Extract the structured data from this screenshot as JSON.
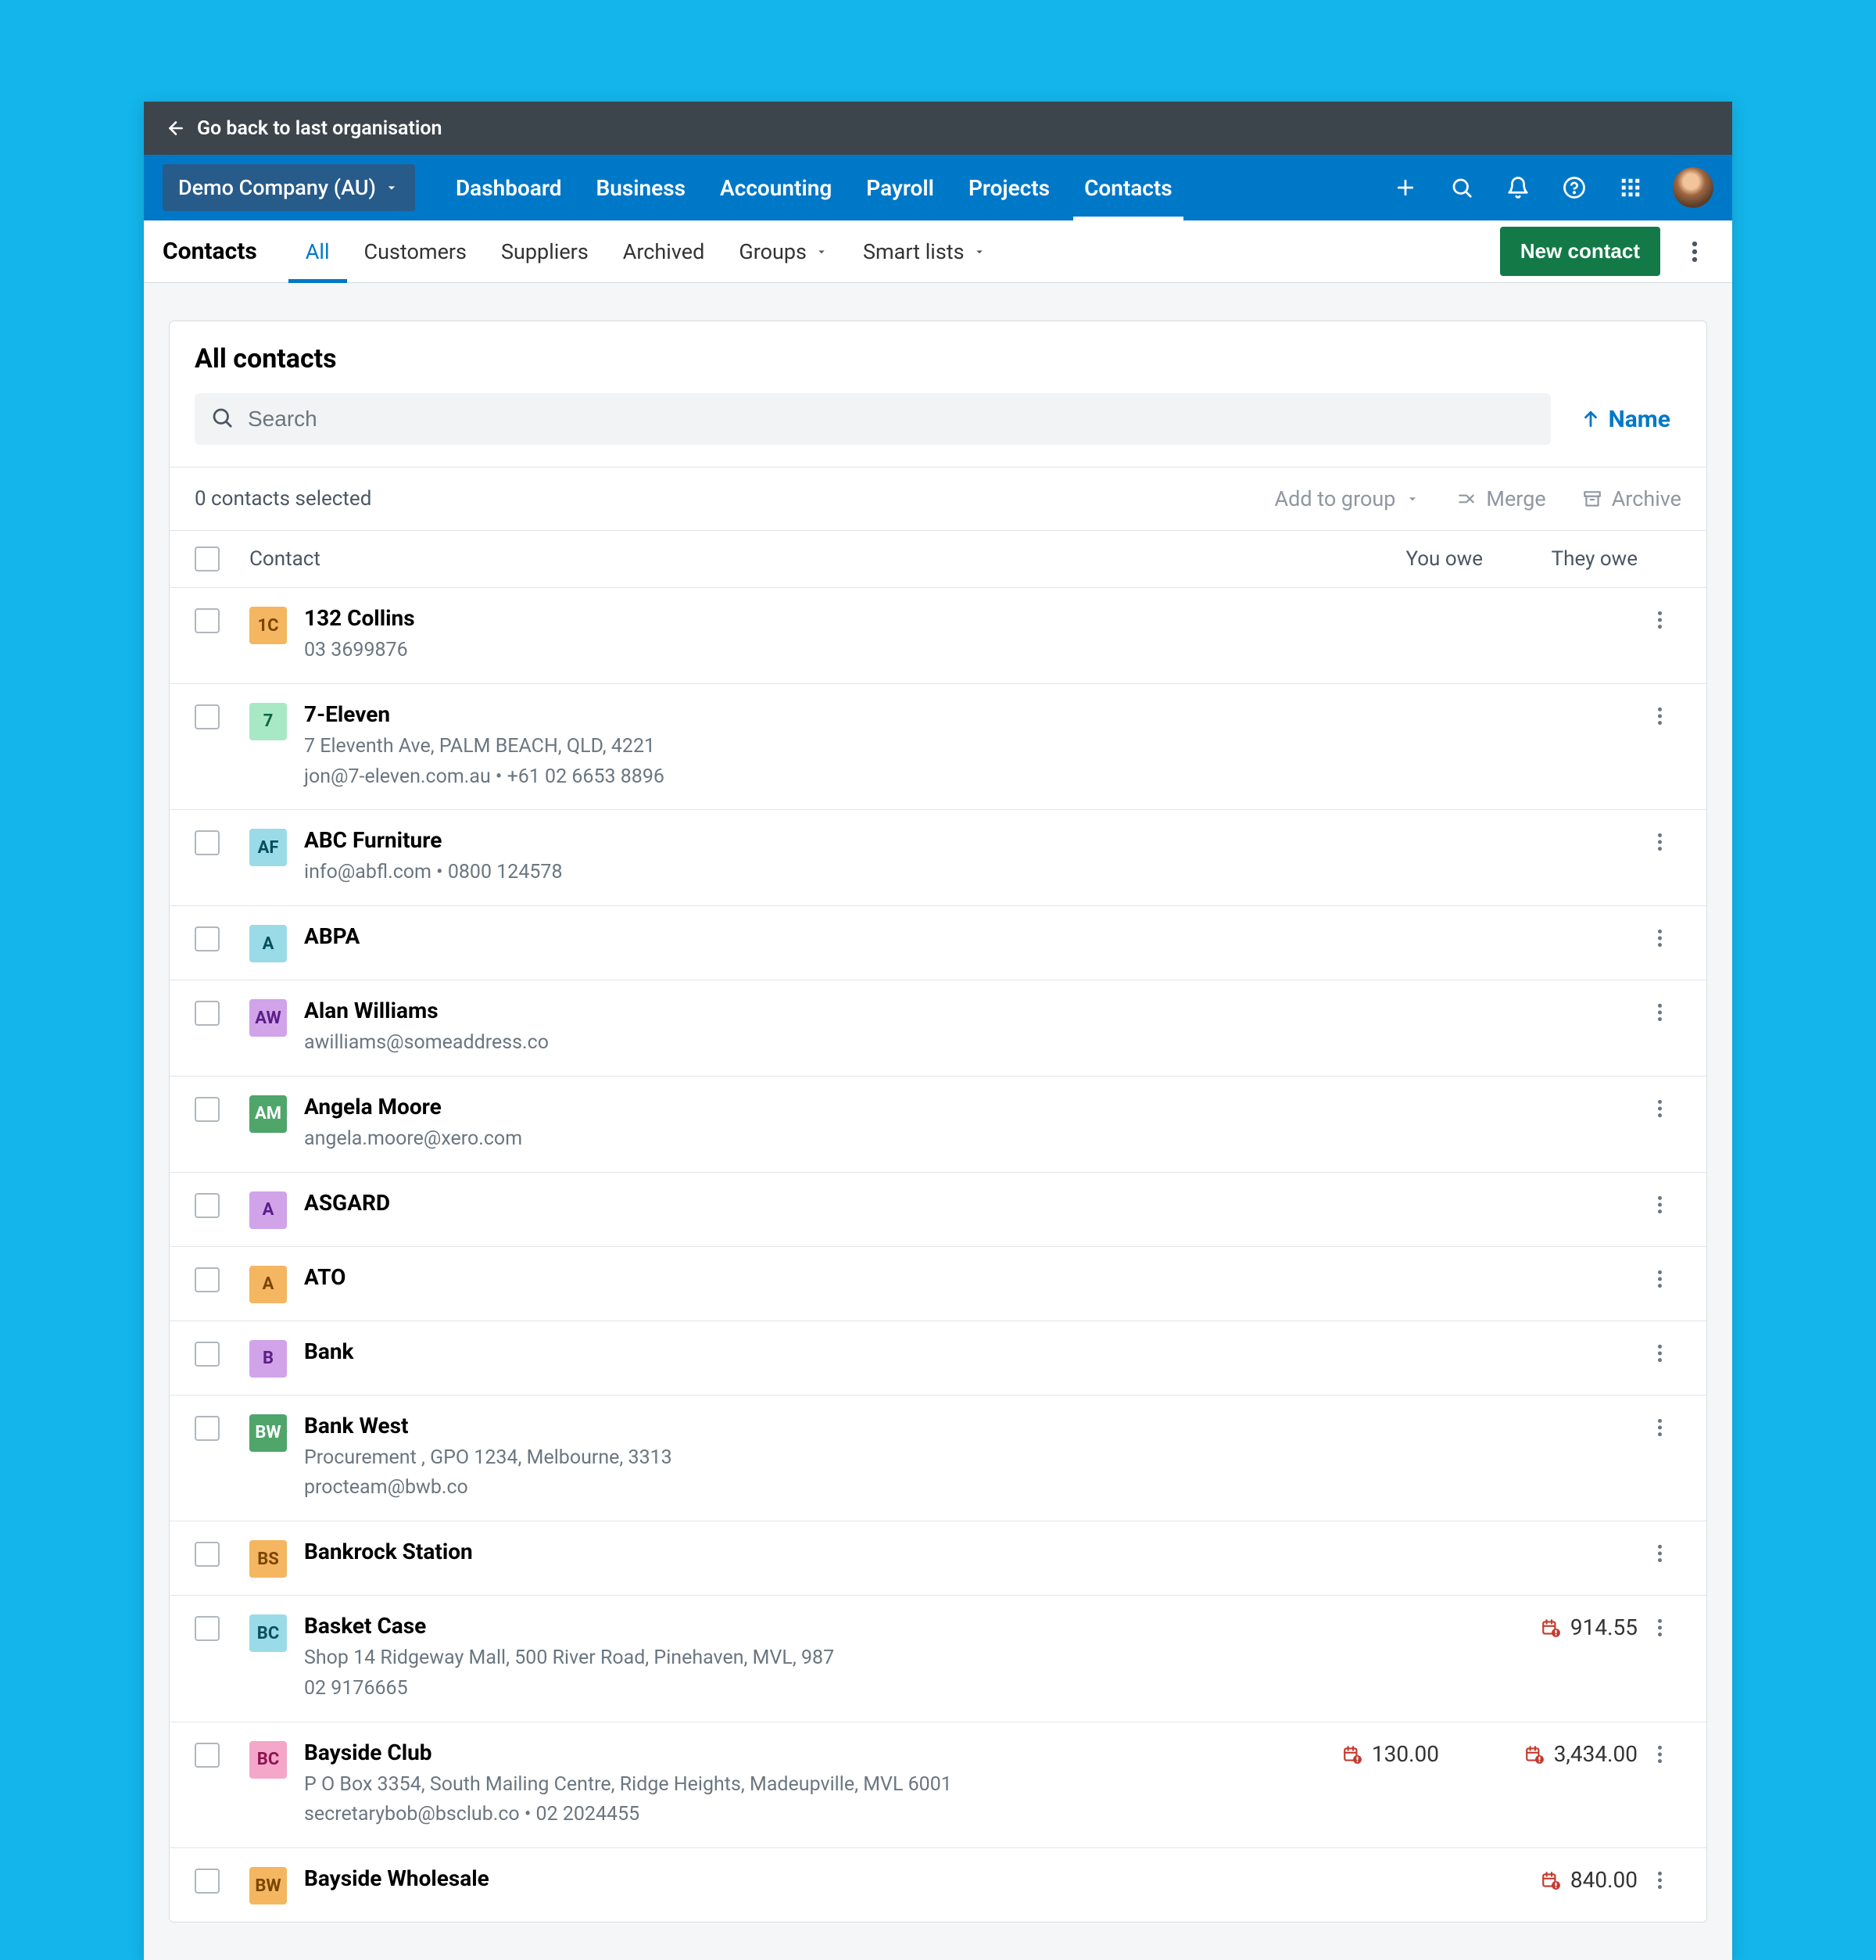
{
  "topbar": {
    "back_label": "Go back to last organisation"
  },
  "org": {
    "name": "Demo Company (AU)"
  },
  "nav": {
    "items": [
      "Dashboard",
      "Business",
      "Accounting",
      "Payroll",
      "Projects",
      "Contacts"
    ],
    "active": 5
  },
  "subnav": {
    "label": "Contacts",
    "tabs": [
      "All",
      "Customers",
      "Suppliers",
      "Archived",
      "Groups",
      "Smart lists"
    ],
    "active": 0,
    "new_button": "New contact"
  },
  "panel": {
    "title": "All contacts",
    "search_placeholder": "Search",
    "sort_label": "Name",
    "selected_text": "0 contacts selected",
    "actions": {
      "add_to_group": "Add to group",
      "merge": "Merge",
      "archive": "Archive"
    },
    "columns": {
      "contact": "Contact",
      "you_owe": "You owe",
      "they_owe": "They owe"
    }
  },
  "contacts": [
    {
      "initials": "1C",
      "bg": "#f4b661",
      "fg": "#7a4500",
      "name": "132 Collins",
      "line1": "03 3699876"
    },
    {
      "initials": "7",
      "bg": "#a8e8c5",
      "fg": "#0a6742",
      "name": "7-Eleven",
      "line1": "7 Eleventh Ave, PALM BEACH, QLD, 4221",
      "line2": "jon@7-eleven.com.au   •   +61 02 6653 8896"
    },
    {
      "initials": "AF",
      "bg": "#9bdbe8",
      "fg": "#064e5d",
      "name": "ABC Furniture",
      "line1": "info@abfl.com   •   0800 124578"
    },
    {
      "initials": "A",
      "bg": "#9bdbe8",
      "fg": "#064e5d",
      "name": "ABPA"
    },
    {
      "initials": "AW",
      "bg": "#d1a3e8",
      "fg": "#5b1e89",
      "name": "Alan Williams",
      "line1": "awilliams@someaddress.co"
    },
    {
      "initials": "AM",
      "bg": "#4fa56a",
      "fg": "#ffffff",
      "name": "Angela Moore",
      "line1": "angela.moore@xero.com"
    },
    {
      "initials": "A",
      "bg": "#d1a3e8",
      "fg": "#5b1e89",
      "name": "ASGARD"
    },
    {
      "initials": "A",
      "bg": "#f4b661",
      "fg": "#7a4500",
      "name": "ATO"
    },
    {
      "initials": "B",
      "bg": "#d1a3e8",
      "fg": "#5b1e89",
      "name": "Bank"
    },
    {
      "initials": "BW",
      "bg": "#4fa56a",
      "fg": "#ffffff",
      "name": "Bank West",
      "line1": "Procurement , GPO 1234, Melbourne, 3313",
      "line2": "procteam@bwb.co"
    },
    {
      "initials": "BS",
      "bg": "#f4b661",
      "fg": "#7a4500",
      "name": "Bankrock Station"
    },
    {
      "initials": "BC",
      "bg": "#9bdbe8",
      "fg": "#064e5d",
      "name": "Basket Case",
      "line1": "Shop 14 Ridgeway Mall, 500 River Road, Pinehaven, MVL, 987",
      "line2": "02 9176665",
      "they_owe": "914.55",
      "they_alert": true
    },
    {
      "initials": "BC",
      "bg": "#f4a7c9",
      "fg": "#8c1452",
      "name": "Bayside Club",
      "line1": "P O Box 3354, South Mailing Centre, Ridge Heights, Madeupville, MVL 6001",
      "line2": "secretarybob@bsclub.co   •   02 2024455",
      "you_owe": "130.00",
      "you_alert": true,
      "they_owe": "3,434.00",
      "they_alert": true
    },
    {
      "initials": "BW",
      "bg": "#f4b661",
      "fg": "#7a4500",
      "name": "Bayside Wholesale",
      "they_owe": "840.00",
      "they_alert": true
    }
  ]
}
